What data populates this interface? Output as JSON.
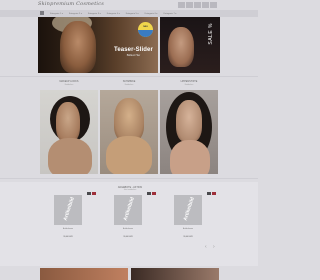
{
  "header": {
    "logo_text": "Skinpremium Cosmetics",
    "icons": [
      "account-icon",
      "wishlist-icon",
      "search-icon",
      "compare-icon",
      "cart-icon"
    ]
  },
  "nav": {
    "items": [
      "Kategorie 1",
      "Kategorie 2",
      "Kategorie 3",
      "Kategorie 4",
      "Kategorie 5",
      "Kategorie 6",
      "Kategorie 7"
    ]
  },
  "hero": {
    "title": "Teaser-Slider",
    "subtitle": "Bildtext Hier",
    "sticker_text": "NEU",
    "side_text": "SALE %"
  },
  "categories": [
    {
      "label": "MAKEUP LOOKS",
      "sub": "Entdecken"
    },
    {
      "label": "SCHMINKE",
      "sub": "Entdecken"
    },
    {
      "label": "LIPPENSTIFTE",
      "sub": "Entdecken"
    }
  ],
  "products": {
    "title": "ANGEBOTE - AKTION",
    "subtitle": "Jetzt entdecken",
    "placeholder": "Artikelbild",
    "items": [
      {
        "name": "Artikelname",
        "price": "99,00 EUR"
      },
      {
        "name": "Artikelname",
        "price": "99,00 EUR"
      },
      {
        "name": "Artikelname",
        "price": "99,00 EUR"
      }
    ],
    "prev": "‹",
    "next": "›"
  },
  "colors": {
    "background": "#dcdbe0",
    "badge_sale": "#9e2f3a",
    "placeholder": "#bcbcc0"
  }
}
